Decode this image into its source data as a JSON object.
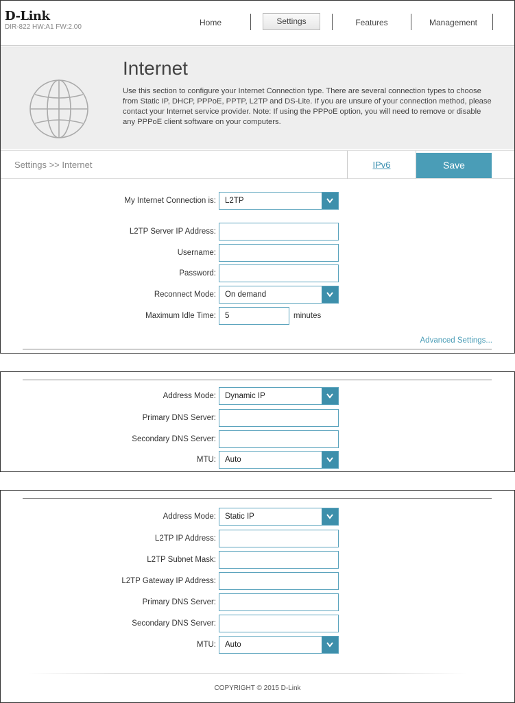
{
  "header": {
    "brand": "D-Link",
    "model_info": "DIR-822 HW:A1 FW:2.00",
    "nav": [
      "Home",
      "Settings",
      "Features",
      "Management"
    ],
    "active_nav": "Settings"
  },
  "banner": {
    "title": "Internet",
    "description": "Use this section to configure your Internet Connection type. There are several connection types to choose from Static IP, DHCP, PPPoE, PPTP, L2TP and DS-Lite. If you are unsure of your connection method, please contact your Internet service provider. Note: If using the PPPoE option, you will need to remove or disable any PPPoE client software on your computers.",
    "icon": "globe-icon"
  },
  "toolbar": {
    "breadcrumb": "Settings >> Internet",
    "ipv6_label": "IPv6",
    "save_label": "Save",
    "accent_color": "#4a9db7"
  },
  "form_main": {
    "connection_label": "My Internet Connection is:",
    "connection_value": "L2TP",
    "server_label": "L2TP Server IP Address:",
    "server_value": "",
    "username_label": "Username:",
    "username_value": "",
    "password_label": "Password:",
    "password_value": "",
    "reconnect_label": "Reconnect Mode:",
    "reconnect_value": "On demand",
    "idle_label": "Maximum Idle Time:",
    "idle_value": "5",
    "idle_unit": "minutes",
    "advanced_link": "Advanced Settings..."
  },
  "form_dynamic": {
    "address_mode_label": "Address Mode:",
    "address_mode_value": "Dynamic IP",
    "primary_dns_label": "Primary DNS Server:",
    "secondary_dns_label": "Secondary DNS Server:",
    "mtu_label": "MTU:",
    "mtu_value": "Auto"
  },
  "form_static": {
    "address_mode_label": "Address Mode:",
    "address_mode_value": "Static IP",
    "ip_label": "L2TP IP Address:",
    "subnet_label": "L2TP Subnet Mask:",
    "gateway_label": "L2TP Gateway IP Address:",
    "primary_dns_label": "Primary DNS Server:",
    "secondary_dns_label": "Secondary DNS Server:",
    "mtu_label": "MTU:",
    "mtu_value": "Auto"
  },
  "footer": {
    "copyright": "COPYRIGHT © 2015 D-Link"
  }
}
